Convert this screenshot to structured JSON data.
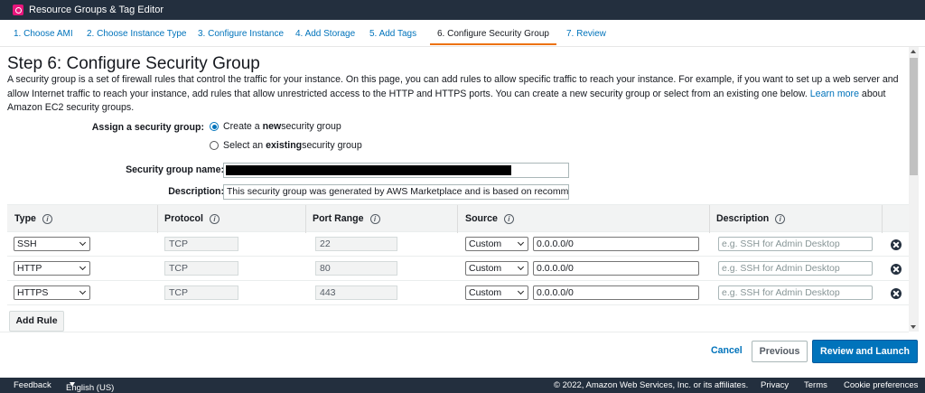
{
  "app": {
    "title": "Resource Groups & Tag Editor"
  },
  "wizard": {
    "steps": [
      {
        "label": "1. Choose AMI"
      },
      {
        "label": "2. Choose Instance Type"
      },
      {
        "label": "3. Configure Instance"
      },
      {
        "label": "4. Add Storage"
      },
      {
        "label": "5. Add Tags"
      },
      {
        "label": "6. Configure Security Group",
        "active": true
      },
      {
        "label": "7. Review"
      }
    ]
  },
  "page": {
    "title": "Step 6: Configure Security Group",
    "intro_text": "A security group is a set of firewall rules that control the traffic for your instance. On this page, you can add rules to allow specific traffic to reach your instance. For example, if you want to set up a web server and allow Internet traffic to reach your instance, add rules that allow unrestricted access to the HTTP and HTTPS ports. You can create a new security group or select from an existing one below.",
    "learn_more": "Learn more",
    "intro_tail": "about Amazon EC2 security groups."
  },
  "form": {
    "assign_label": "Assign a security group:",
    "option_create_pre": "Create a ",
    "option_create_bold": "new",
    "option_create_post": " security group",
    "option_select_pre": "Select an ",
    "option_select_bold": "existing",
    "option_select_post": " security group",
    "selected_option": "create",
    "name_label": "Security group name:",
    "name_value": "",
    "desc_label": "Description:",
    "desc_value": "This security group was generated by AWS Marketplace and is based on recommended settings"
  },
  "rules": {
    "headers": {
      "type": "Type",
      "protocol": "Protocol",
      "port_range": "Port Range",
      "source": "Source",
      "description": "Description"
    },
    "info_glyph": "i",
    "desc_placeholder": "e.g. SSH for Admin Desktop",
    "rows": [
      {
        "type": "SSH",
        "protocol": "TCP",
        "port": "22",
        "source_type": "Custom",
        "source": "0.0.0.0/0"
      },
      {
        "type": "HTTP",
        "protocol": "TCP",
        "port": "80",
        "source_type": "Custom",
        "source": "0.0.0.0/0"
      },
      {
        "type": "HTTPS",
        "protocol": "TCP",
        "port": "443",
        "source_type": "Custom",
        "source": "0.0.0.0/0"
      }
    ],
    "add_rule_label": "Add Rule"
  },
  "actions": {
    "cancel": "Cancel",
    "previous": "Previous",
    "review_launch": "Review and Launch"
  },
  "footer": {
    "feedback": "Feedback",
    "language": "English (US)",
    "copyright": "© 2022, Amazon Web Services, Inc. or its affiliates.",
    "privacy": "Privacy",
    "terms": "Terms",
    "cookies": "Cookie preferences"
  },
  "colors": {
    "header_bg": "#232f3e",
    "link": "#0073bb",
    "active_tab": "#ec7211",
    "primary_button": "#0073bb",
    "logo": "#e7157b"
  }
}
